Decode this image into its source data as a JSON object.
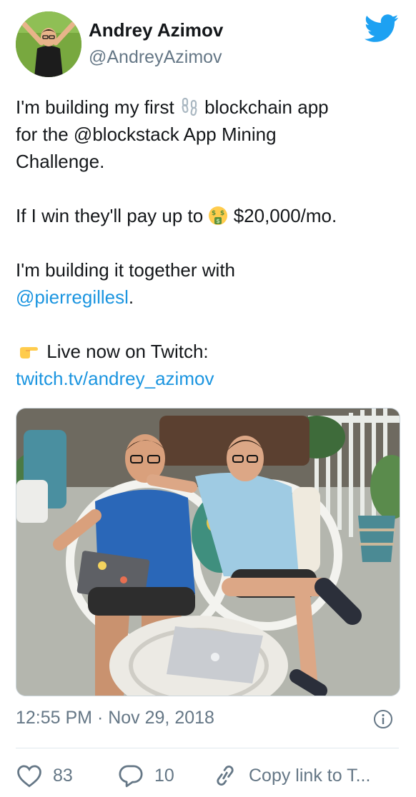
{
  "author": {
    "name": "Andrey Azimov",
    "handle": "@AndreyAzimov"
  },
  "icons": {
    "brand": "twitter-bird-icon",
    "chain_emoji": "chain-icon",
    "money_face_emoji": "money-mouth-face-icon",
    "pointing_emoji": "pointing-right-icon",
    "info": "info-icon",
    "like": "heart-icon",
    "reply": "reply-bubble-icon",
    "copy_link": "link-icon"
  },
  "tweet": {
    "line1_a": "I'm building my first",
    "line1_b": "blockchain app",
    "line2": "for the @blockstack App Mining",
    "line3": "Challenge.",
    "line4_a": "If I win they'll pay up to",
    "line4_b": "$20,000/mo.",
    "line5": "I'm building it together with",
    "mention": "@pierregillesl",
    "mention_suffix": ".",
    "live_text": "Live now on Twitch:",
    "twitch_link": "twitch.tv/andrey_azimov"
  },
  "timestamp": "12:55 PM · Nov 29, 2018",
  "actions": {
    "likes_count": "83",
    "replies_count": "10",
    "copy_link_label": "Copy link to T..."
  },
  "colors": {
    "link": "#1b95e0",
    "secondary_text": "#657786",
    "twitter_blue": "#1da1f2"
  }
}
